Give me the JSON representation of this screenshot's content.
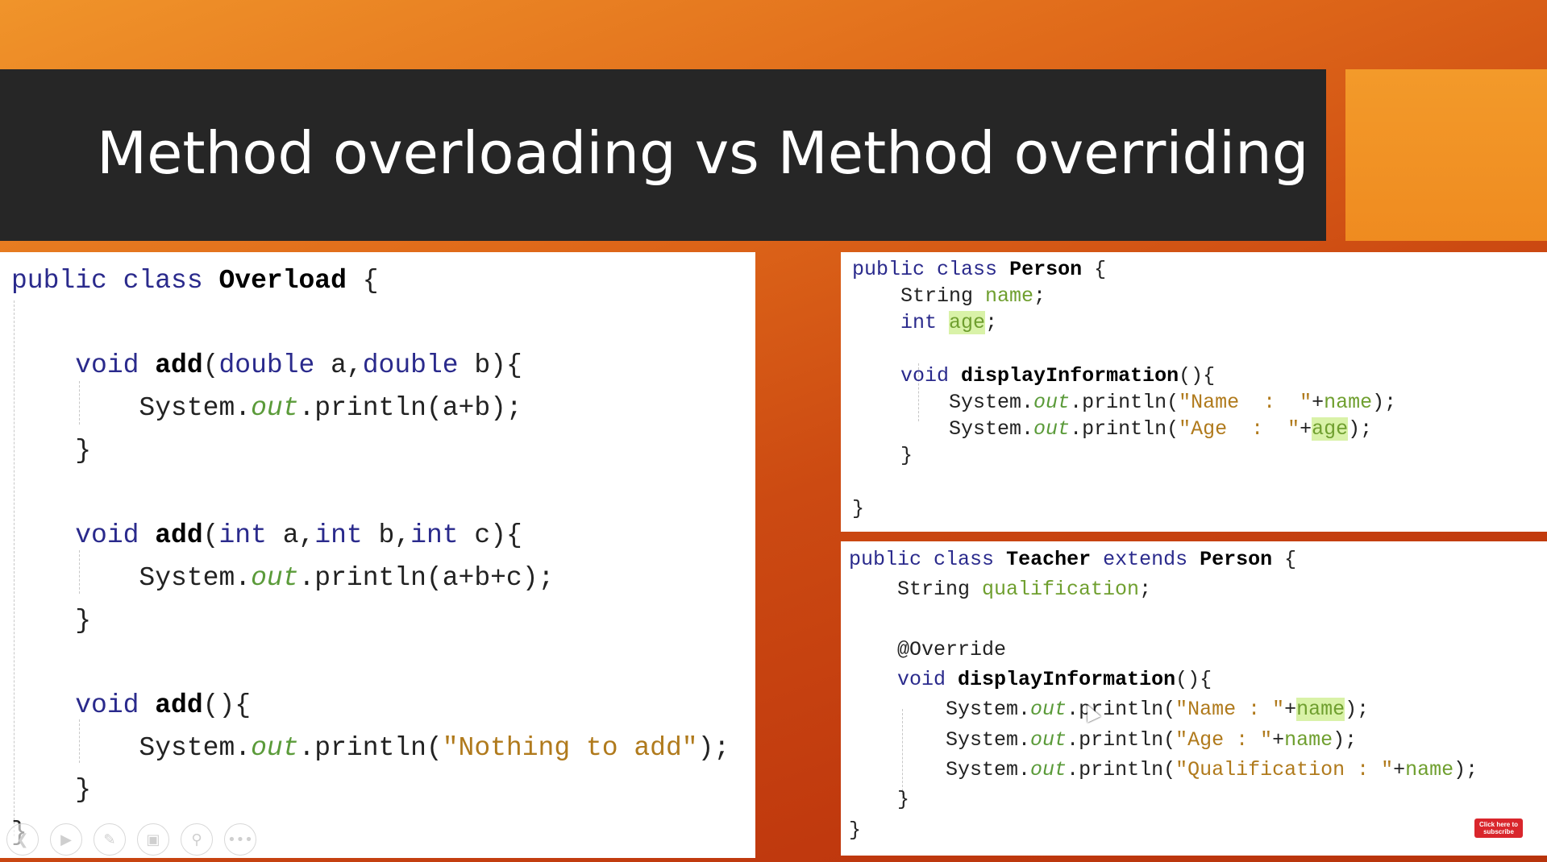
{
  "slide": {
    "title": "Method overloading vs Method overriding"
  },
  "overload_code": {
    "lines": [
      "public class Overload {",
      "",
      "    void add(double a,double b){",
      "        System.out.println(a+b);",
      "    }",
      "",
      "    void add(int a,int b,int c){",
      "        System.out.println(a+b+c);",
      "    }",
      "",
      "    void add(){",
      "        System.out.println(\"Nothing to add\");",
      "    }",
      "}"
    ]
  },
  "person_code": {
    "lines": [
      "public class Person {",
      "    String name;",
      "    int age;",
      "",
      "    void displayInformation(){",
      "        System.out.println(\"Name  :  \"+name);",
      "        System.out.println(\"Age  :  \"+age);",
      "    }",
      "",
      "}"
    ]
  },
  "teacher_code": {
    "lines": [
      "public class Teacher extends Person {",
      "    String qualification;",
      "",
      "    @Override",
      "    void displayInformation(){",
      "        System.out.println(\"Name : \"+name);",
      "        System.out.println(\"Age : \"+name);",
      "        System.out.println(\"Qualification : \"+name);",
      "    }",
      "}"
    ]
  },
  "toolbar": {
    "buttons": [
      {
        "icon": "back-arrow-icon",
        "glyph": "❮"
      },
      {
        "icon": "play-icon",
        "glyph": "▶"
      },
      {
        "icon": "pen-icon",
        "glyph": "✎"
      },
      {
        "icon": "slides-icon",
        "glyph": "▣"
      },
      {
        "icon": "zoom-icon",
        "glyph": "⚲"
      },
      {
        "icon": "more-icon",
        "glyph": "•••"
      }
    ]
  },
  "subscribe": {
    "line1": "Click here to",
    "line2": "subscribe"
  },
  "colors": {
    "title_bar": "#262626",
    "accent": "#ef8b20",
    "keyword": "#2a2a8c",
    "field": "#6f9f2f",
    "string": "#b07a1c",
    "highlight": "#d9f2a8"
  }
}
